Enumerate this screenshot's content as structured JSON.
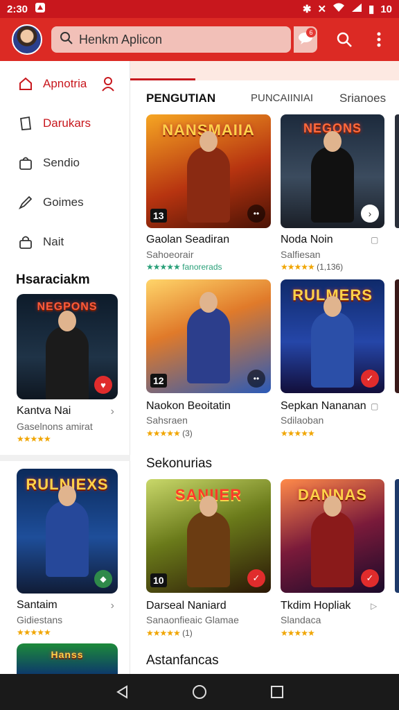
{
  "status": {
    "time": "2:30",
    "battery": "10"
  },
  "search": {
    "placeholder": "Henkm Aplicon"
  },
  "notification_count": "6",
  "sidebar": {
    "items": [
      {
        "label": "Apnotria",
        "icon": "home-icon"
      },
      {
        "label": "Darukars",
        "icon": "bookmark-icon"
      },
      {
        "label": "Sendio",
        "icon": "bag-icon"
      },
      {
        "label": "Goimes",
        "icon": "pen-icon"
      },
      {
        "label": "Nait",
        "icon": "lock-icon"
      }
    ],
    "section_title": "Hsaraciakm",
    "cards": [
      {
        "thumb_title": "NEGPONS",
        "name": "Kantva Nai",
        "sub": "Gaselnons amirat"
      },
      {
        "thumb_title": "RULNIEXS",
        "name": "Santaim",
        "sub": "Gidiestans"
      },
      {
        "thumb_title": "Hanss",
        "name": "",
        "sub": ""
      }
    ]
  },
  "main": {
    "tabs": [
      "PENGUTIAN",
      "PUNCAIINIAI",
      "Srianoes"
    ],
    "grid": [
      {
        "thumb_title": "NANSMAIIA",
        "name": "Gaolan Seadiran",
        "sub": "Sahoeorair",
        "rating": "",
        "tag": "fanorerads",
        "num": "13",
        "action": "dots"
      },
      {
        "thumb_title": "NEGONS",
        "name": "Noda Noin",
        "sub": "Salfiesan",
        "rating": "(1,136)",
        "tag": "",
        "num": "",
        "action": "arrow"
      },
      {
        "thumb_title": "",
        "name": "Naokon Beoitatin",
        "sub": "Sahsraen",
        "rating": "(3)",
        "tag": "",
        "num": "12",
        "action": "dots"
      },
      {
        "thumb_title": "RULMERS",
        "name": "Sepkan Nananan",
        "sub": "Sdilaoban",
        "rating": "",
        "tag": "",
        "num": "",
        "action": "check"
      }
    ],
    "section2_title": "Sekonurias",
    "grid2": [
      {
        "thumb_title": "SANIIER",
        "name": "Darseal Naniard",
        "sub": "Sanaonfieaic Glamae",
        "rating": "(1)",
        "num": "10",
        "action": "check"
      },
      {
        "thumb_title": "DANNAS",
        "name": "Tkdim Hopliak",
        "sub": "Slandaca",
        "rating": "",
        "num": "",
        "action": "check"
      }
    ],
    "section3_title": "Astanfancas"
  },
  "colors": {
    "brand": "#dc2a24",
    "accent": "#c8171d",
    "star": "#f0a500"
  }
}
